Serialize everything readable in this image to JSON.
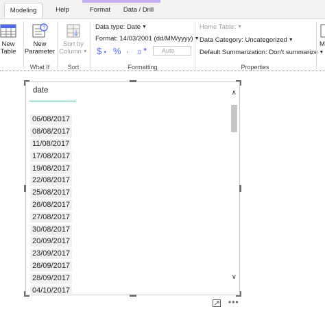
{
  "tabs": [
    {
      "label": "Modeling",
      "active": true
    },
    {
      "label": "Help",
      "active": false
    },
    {
      "label": "Format",
      "active": false
    },
    {
      "label": "Data / Drill",
      "active": false
    }
  ],
  "ribbon": {
    "new_table": {
      "line1": "New",
      "line2": "Table"
    },
    "new_parameter": {
      "line1": "New",
      "line2": "Parameter"
    },
    "what_if_label": "What If",
    "sort_by_column": {
      "line1": "Sort by",
      "line2": "Column"
    },
    "sort_label": "Sort",
    "formatting": {
      "data_type": "Data type: Date",
      "format": "Format: 14/03/2001 (dd/MM/yyyy)",
      "currency_symbol": "$",
      "percent_symbol": "%",
      "comma_symbol": ",",
      "auto_value": "Auto",
      "label": "Formatting"
    },
    "properties": {
      "home_table": "Home Table:",
      "data_category": "Data Category: Uncategorized",
      "default_summarization": "Default Summarization: Don't summarize",
      "label": "Properties"
    },
    "overflow_letter": "M"
  },
  "slicer": {
    "header": "date",
    "items": [
      "06/08/2017",
      "08/08/2017",
      "11/08/2017",
      "17/08/2017",
      "19/08/2017",
      "22/08/2017",
      "25/08/2017",
      "26/08/2017",
      "27/08/2017",
      "30/08/2017",
      "20/09/2017",
      "23/09/2017",
      "26/09/2017",
      "28/09/2017",
      "04/10/2017"
    ]
  },
  "icons": {
    "focus_mode": "focus-mode-icon",
    "more_options": "more-options-icon"
  },
  "colors": {
    "accent_underline": "#36b0a4",
    "context_tab_band": "#c4b0f2",
    "format_symbols": "#4f6bed"
  }
}
